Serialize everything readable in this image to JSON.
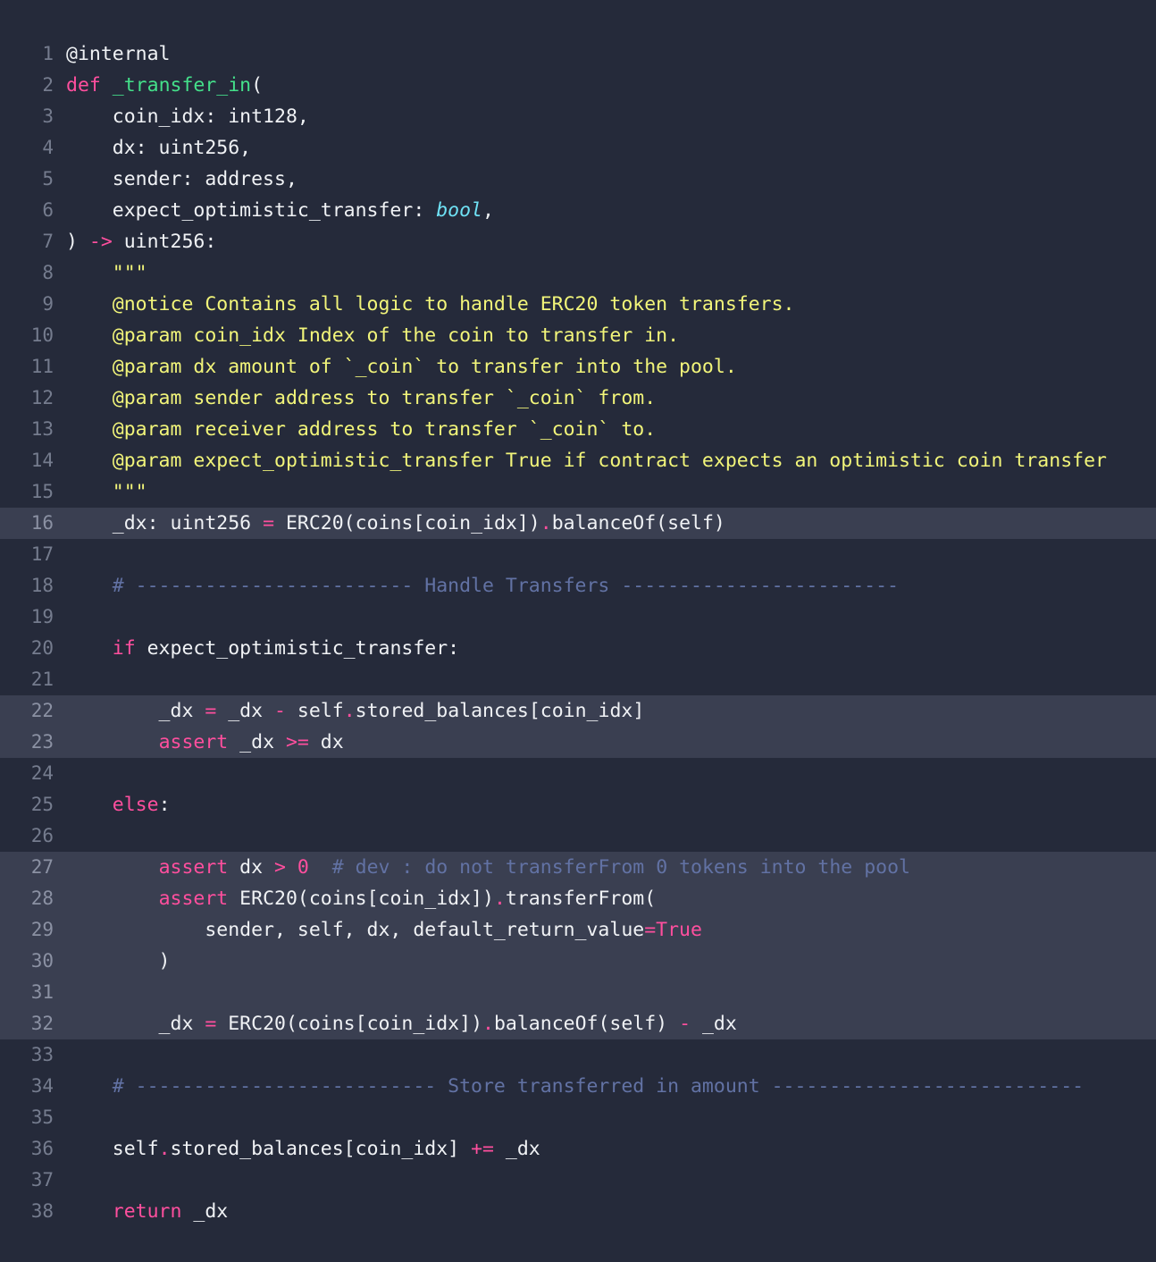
{
  "editor": {
    "language": "vyper",
    "background_color": "#252a3a",
    "highlight_color": "#3a3f51",
    "gutter_color": "#757c8e",
    "text_color": "#f0f2f5",
    "keyword_color": "#ff4f9e",
    "function_color": "#44e08a",
    "docstring_color": "#f2f57a",
    "comment_color": "#6272a4",
    "type_color": "#6fe2f5",
    "first_line_number": 1,
    "last_line_number": 38
  },
  "lines": [
    {
      "n": "1",
      "hl": false,
      "tokens": [
        {
          "t": "@internal",
          "c": "plain"
        }
      ]
    },
    {
      "n": "2",
      "hl": false,
      "tokens": [
        {
          "t": "def",
          "c": "kw"
        },
        {
          "t": " ",
          "c": "plain"
        },
        {
          "t": "_transfer_in",
          "c": "fn"
        },
        {
          "t": "(",
          "c": "plain"
        }
      ]
    },
    {
      "n": "3",
      "hl": false,
      "tokens": [
        {
          "t": "    coin_idx: int128,",
          "c": "plain"
        }
      ]
    },
    {
      "n": "4",
      "hl": false,
      "tokens": [
        {
          "t": "    dx: uint256,",
          "c": "plain"
        }
      ]
    },
    {
      "n": "5",
      "hl": false,
      "tokens": [
        {
          "t": "    sender: address,",
          "c": "plain"
        }
      ]
    },
    {
      "n": "6",
      "hl": false,
      "tokens": [
        {
          "t": "    expect_optimistic_transfer: ",
          "c": "plain"
        },
        {
          "t": "bool",
          "c": "typ"
        },
        {
          "t": ",",
          "c": "plain"
        }
      ]
    },
    {
      "n": "7",
      "hl": false,
      "tokens": [
        {
          "t": ") ",
          "c": "plain"
        },
        {
          "t": "->",
          "c": "op"
        },
        {
          "t": " uint256:",
          "c": "plain"
        }
      ]
    },
    {
      "n": "8",
      "hl": false,
      "tokens": [
        {
          "t": "    \"\"\"",
          "c": "doc"
        }
      ]
    },
    {
      "n": "9",
      "hl": false,
      "tokens": [
        {
          "t": "    @notice Contains all logic to handle ERC20 token transfers.",
          "c": "doc"
        }
      ]
    },
    {
      "n": "10",
      "hl": false,
      "tokens": [
        {
          "t": "    @param coin_idx Index of the coin to transfer in.",
          "c": "doc"
        }
      ]
    },
    {
      "n": "11",
      "hl": false,
      "tokens": [
        {
          "t": "    @param dx amount of `_coin` to transfer into the pool.",
          "c": "doc"
        }
      ]
    },
    {
      "n": "12",
      "hl": false,
      "tokens": [
        {
          "t": "    @param sender address to transfer `_coin` from.",
          "c": "doc"
        }
      ]
    },
    {
      "n": "13",
      "hl": false,
      "tokens": [
        {
          "t": "    @param receiver address to transfer `_coin` to.",
          "c": "doc"
        }
      ]
    },
    {
      "n": "14",
      "hl": false,
      "tokens": [
        {
          "t": "    @param expect_optimistic_transfer True if contract expects an optimistic coin transfer",
          "c": "doc"
        }
      ]
    },
    {
      "n": "15",
      "hl": false,
      "tokens": [
        {
          "t": "    \"\"\"",
          "c": "doc"
        }
      ]
    },
    {
      "n": "16",
      "hl": true,
      "tokens": [
        {
          "t": "    _dx: uint256 ",
          "c": "plain"
        },
        {
          "t": "=",
          "c": "op"
        },
        {
          "t": " ERC20(coins[coin_idx])",
          "c": "plain"
        },
        {
          "t": ".",
          "c": "op"
        },
        {
          "t": "balanceOf(self)",
          "c": "plain"
        }
      ]
    },
    {
      "n": "17",
      "hl": false,
      "tokens": [
        {
          "t": "",
          "c": "plain"
        }
      ]
    },
    {
      "n": "18",
      "hl": false,
      "tokens": [
        {
          "t": "    # ------------------------ Handle Transfers ------------------------",
          "c": "cm"
        }
      ]
    },
    {
      "n": "19",
      "hl": false,
      "tokens": [
        {
          "t": "",
          "c": "plain"
        }
      ]
    },
    {
      "n": "20",
      "hl": false,
      "tokens": [
        {
          "t": "    ",
          "c": "plain"
        },
        {
          "t": "if",
          "c": "kw"
        },
        {
          "t": " expect_optimistic_transfer:",
          "c": "plain"
        }
      ]
    },
    {
      "n": "21",
      "hl": false,
      "tokens": [
        {
          "t": "",
          "c": "plain"
        }
      ]
    },
    {
      "n": "22",
      "hl": true,
      "tokens": [
        {
          "t": "        _dx ",
          "c": "plain"
        },
        {
          "t": "=",
          "c": "op"
        },
        {
          "t": " _dx ",
          "c": "plain"
        },
        {
          "t": "-",
          "c": "op"
        },
        {
          "t": " self",
          "c": "plain"
        },
        {
          "t": ".",
          "c": "op"
        },
        {
          "t": "stored_balances[coin_idx]",
          "c": "plain"
        }
      ]
    },
    {
      "n": "23",
      "hl": true,
      "tokens": [
        {
          "t": "        ",
          "c": "plain"
        },
        {
          "t": "assert",
          "c": "kw"
        },
        {
          "t": " _dx ",
          "c": "plain"
        },
        {
          "t": ">=",
          "c": "op"
        },
        {
          "t": " dx",
          "c": "plain"
        }
      ]
    },
    {
      "n": "24",
      "hl": false,
      "tokens": [
        {
          "t": "",
          "c": "plain"
        }
      ]
    },
    {
      "n": "25",
      "hl": false,
      "tokens": [
        {
          "t": "    ",
          "c": "plain"
        },
        {
          "t": "else",
          "c": "kw"
        },
        {
          "t": ":",
          "c": "plain"
        }
      ]
    },
    {
      "n": "26",
      "hl": false,
      "tokens": [
        {
          "t": "",
          "c": "plain"
        }
      ]
    },
    {
      "n": "27",
      "hl": true,
      "tokens": [
        {
          "t": "        ",
          "c": "plain"
        },
        {
          "t": "assert",
          "c": "kw"
        },
        {
          "t": " dx ",
          "c": "plain"
        },
        {
          "t": ">",
          "c": "op"
        },
        {
          "t": " ",
          "c": "plain"
        },
        {
          "t": "0",
          "c": "num"
        },
        {
          "t": "  # dev : do not transferFrom 0 tokens into the pool",
          "c": "cm"
        }
      ]
    },
    {
      "n": "28",
      "hl": true,
      "tokens": [
        {
          "t": "        ",
          "c": "plain"
        },
        {
          "t": "assert",
          "c": "kw"
        },
        {
          "t": " ERC20(coins[coin_idx])",
          "c": "plain"
        },
        {
          "t": ".",
          "c": "op"
        },
        {
          "t": "transferFrom(",
          "c": "plain"
        }
      ]
    },
    {
      "n": "29",
      "hl": true,
      "tokens": [
        {
          "t": "            sender, self, dx, default_return_value",
          "c": "plain"
        },
        {
          "t": "=",
          "c": "op"
        },
        {
          "t": "True",
          "c": "kw"
        }
      ]
    },
    {
      "n": "30",
      "hl": true,
      "tokens": [
        {
          "t": "        )",
          "c": "plain"
        }
      ]
    },
    {
      "n": "31",
      "hl": true,
      "tokens": [
        {
          "t": "",
          "c": "plain"
        }
      ]
    },
    {
      "n": "32",
      "hl": true,
      "tokens": [
        {
          "t": "        _dx ",
          "c": "plain"
        },
        {
          "t": "=",
          "c": "op"
        },
        {
          "t": " ERC20(coins[coin_idx])",
          "c": "plain"
        },
        {
          "t": ".",
          "c": "op"
        },
        {
          "t": "balanceOf(self) ",
          "c": "plain"
        },
        {
          "t": "-",
          "c": "op"
        },
        {
          "t": " _dx",
          "c": "plain"
        }
      ]
    },
    {
      "n": "33",
      "hl": false,
      "tokens": [
        {
          "t": "",
          "c": "plain"
        }
      ]
    },
    {
      "n": "34",
      "hl": false,
      "tokens": [
        {
          "t": "    # -------------------------- Store transferred in amount ---------------------------",
          "c": "cm"
        }
      ]
    },
    {
      "n": "35",
      "hl": false,
      "tokens": [
        {
          "t": "",
          "c": "plain"
        }
      ]
    },
    {
      "n": "36",
      "hl": false,
      "tokens": [
        {
          "t": "    self",
          "c": "plain"
        },
        {
          "t": ".",
          "c": "op"
        },
        {
          "t": "stored_balances[coin_idx] ",
          "c": "plain"
        },
        {
          "t": "+=",
          "c": "op"
        },
        {
          "t": " _dx",
          "c": "plain"
        }
      ]
    },
    {
      "n": "37",
      "hl": false,
      "tokens": [
        {
          "t": "",
          "c": "plain"
        }
      ]
    },
    {
      "n": "38",
      "hl": false,
      "tokens": [
        {
          "t": "    ",
          "c": "plain"
        },
        {
          "t": "return",
          "c": "kw"
        },
        {
          "t": " _dx",
          "c": "plain"
        }
      ]
    }
  ]
}
